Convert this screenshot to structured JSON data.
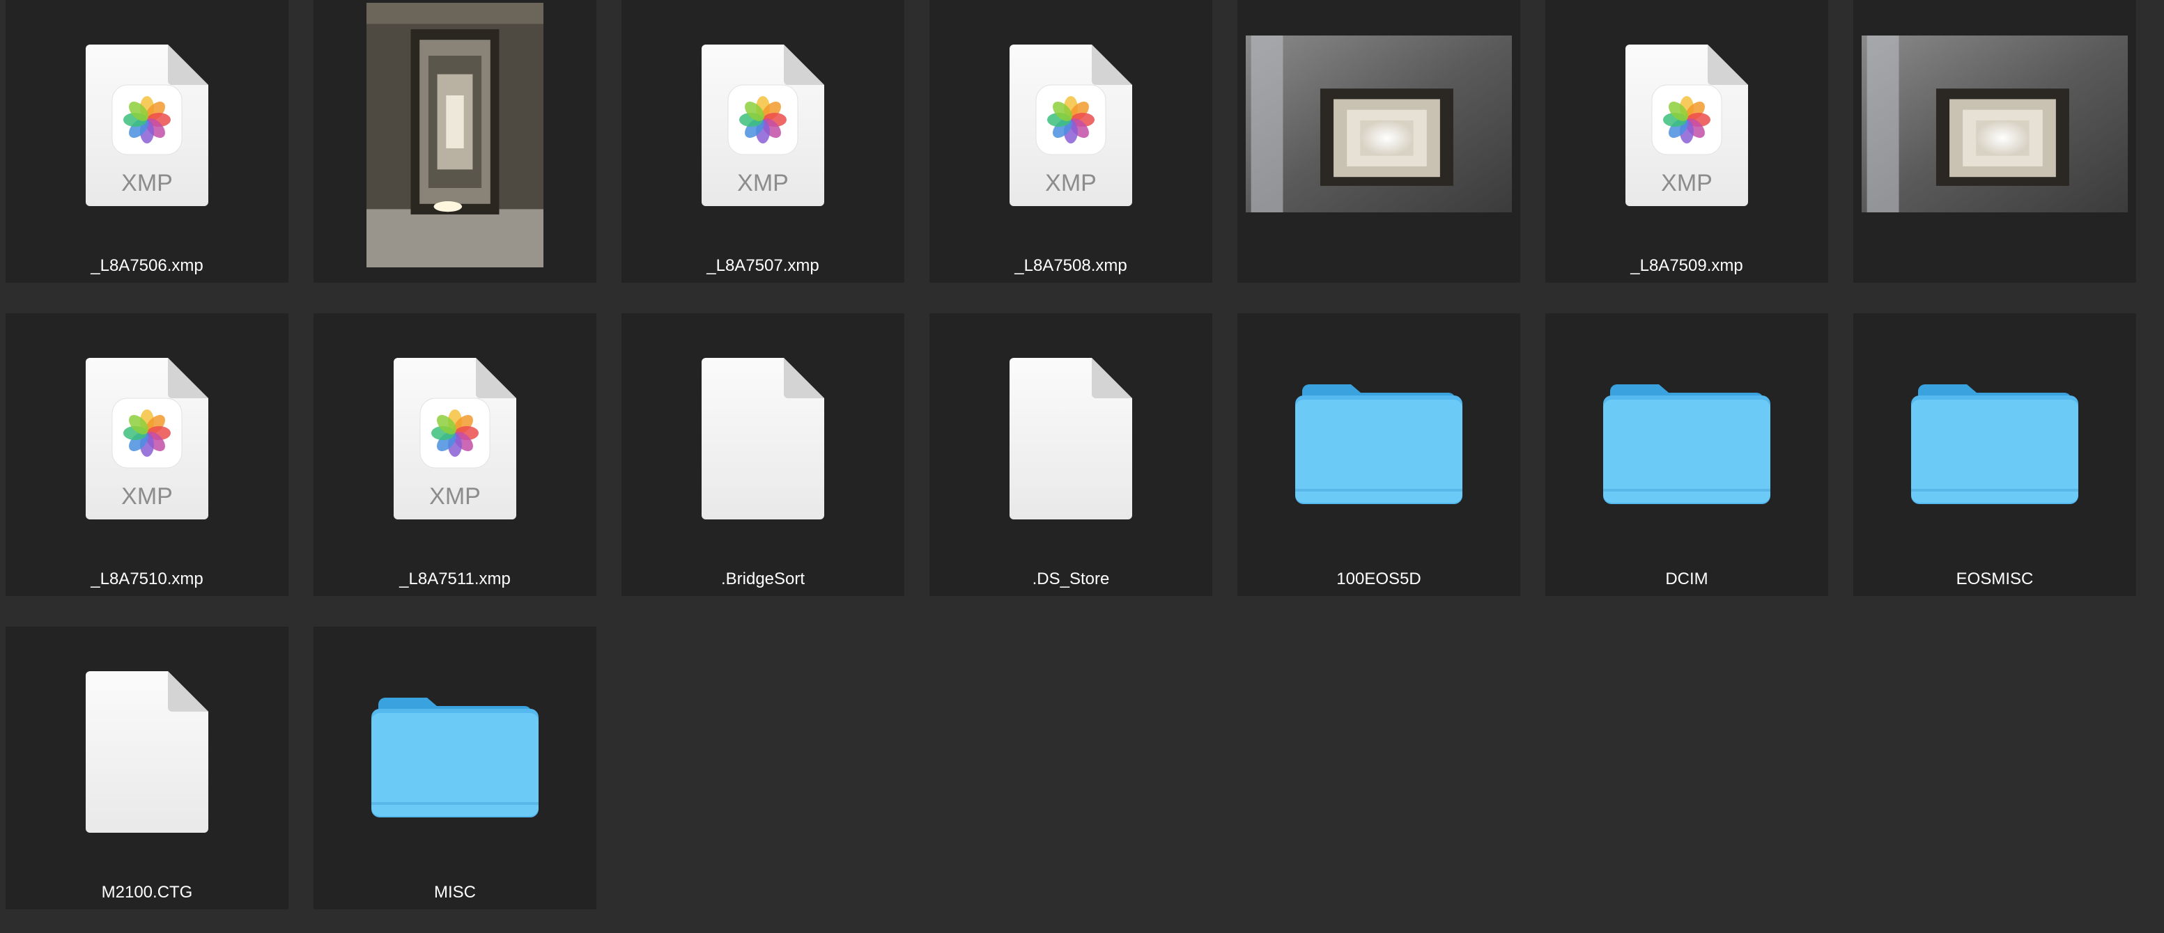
{
  "files": [
    {
      "type": "xmp",
      "name": "_L8A7506.xmp",
      "badge": "XMP",
      "icon": "photos-xmp-icon"
    },
    {
      "type": "photo-portrait",
      "name": "",
      "icon": "stairwell-photo-thumbnail"
    },
    {
      "type": "xmp",
      "name": "_L8A7507.xmp",
      "badge": "XMP",
      "icon": "photos-xmp-icon"
    },
    {
      "type": "xmp",
      "name": "_L8A7508.xmp",
      "badge": "XMP",
      "icon": "photos-xmp-icon"
    },
    {
      "type": "photo-landscape",
      "name": "",
      "icon": "stairwell-photo-thumbnail"
    },
    {
      "type": "xmp",
      "name": "_L8A7509.xmp",
      "badge": "XMP",
      "icon": "photos-xmp-icon"
    },
    {
      "type": "photo-landscape",
      "name": "",
      "icon": "stairwell-photo-thumbnail"
    },
    {
      "type": "xmp",
      "name": "_L8A7510.xmp",
      "badge": "XMP",
      "icon": "photos-xmp-icon"
    },
    {
      "type": "xmp",
      "name": "_L8A7511.xmp",
      "badge": "XMP",
      "icon": "photos-xmp-icon"
    },
    {
      "type": "doc",
      "name": ".BridgeSort",
      "icon": "blank-document-icon"
    },
    {
      "type": "doc",
      "name": ".DS_Store",
      "icon": "blank-document-icon"
    },
    {
      "type": "folder",
      "name": "100EOS5D",
      "icon": "folder-icon"
    },
    {
      "type": "folder",
      "name": "DCIM",
      "icon": "folder-icon"
    },
    {
      "type": "folder",
      "name": "EOSMISC",
      "icon": "folder-icon"
    },
    {
      "type": "doc",
      "name": "M2100.CTG",
      "icon": "blank-document-icon"
    },
    {
      "type": "folder",
      "name": "MISC",
      "icon": "folder-icon"
    }
  ],
  "colors": {
    "background": "#2d2d2d",
    "tile": "#232323",
    "folder": "#6ccaf7",
    "folder_tab": "#3aa3df",
    "label": "#ffffff"
  }
}
